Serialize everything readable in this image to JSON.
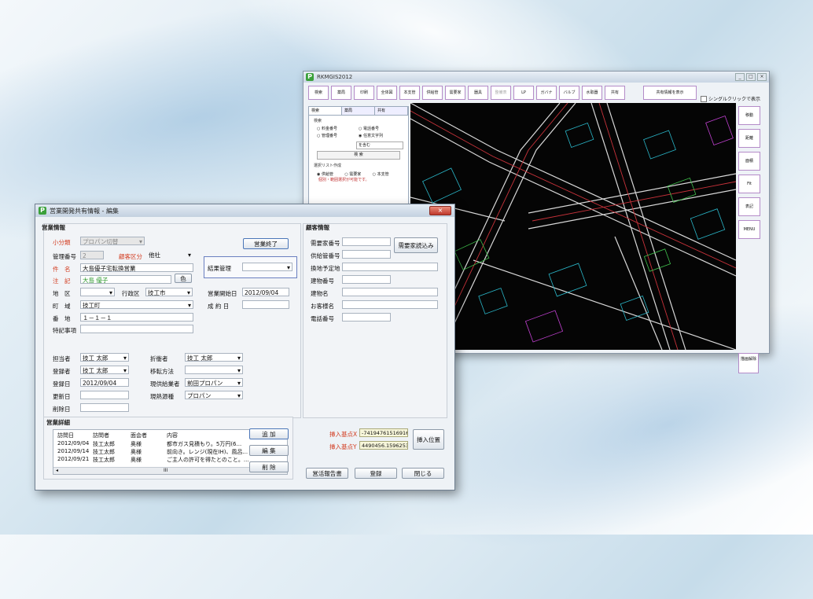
{
  "back_window": {
    "title": "RKMGIS2012",
    "toolbar": [
      "検索",
      "薬局",
      "印刷",
      "全体図",
      "本支管",
      "供給管",
      "需要家",
      "器具",
      "整備表",
      "LP",
      "ガバナ",
      "バルブ",
      "水取器",
      "共有"
    ],
    "toolbar_disabled_index": 8,
    "show_all_label": "共有情報を表示",
    "single_click_label": "シングルクリックで表示",
    "side_buttons": [
      "移動",
      "距離",
      "面積",
      "Fit",
      "表記",
      "MENU",
      "描画解除"
    ],
    "left_panel": {
      "tabs": [
        "検索",
        "薬局",
        "共有"
      ],
      "section_title": "検索",
      "radios": [
        {
          "label": "料金番号",
          "on": false
        },
        {
          "label": "電話番号",
          "on": false
        },
        {
          "label": "管理番号",
          "on": false
        },
        {
          "label": "任意文字列",
          "on": true
        }
      ],
      "select_value": "を含む",
      "search_button": "検 索",
      "list_title": "選択リスト作成",
      "list_radios": [
        "供給管",
        "需要家",
        "本支管"
      ],
      "list_note": "個別・範囲選択が可能です。"
    },
    "map_colors": {
      "line": "#d8d8d8",
      "red": "#c8323a",
      "cyan": "#2ab6c8",
      "green": "#3fbf4c",
      "magenta": "#c040d0"
    }
  },
  "front_window": {
    "title": "営業開発共有情報 - 編集",
    "close_label": "×",
    "sales_info": {
      "section_title": "営業情報",
      "small_category_label": "小分類",
      "small_category_value": "プロパン切替",
      "end_sales_button": "営業終了",
      "mgmt_no_label": "管理番号",
      "mgmt_no_value": "2",
      "customer_type_label": "顧客区分",
      "customer_type_value": "他社",
      "subject_label": "件　名",
      "subject_value": "大島優子宅転換営業",
      "note_label": "注　記",
      "note_value": "大島 優子",
      "color_button": "色",
      "result_label": "結果管理",
      "area_label": "地　区",
      "ward_label": "行政区",
      "ward_value": "技工市",
      "sales_start_label": "営業開始日",
      "sales_start_value": "2012/09/04",
      "town_label": "町　域",
      "town_value": "技工町",
      "contract_date_label": "成 約 日",
      "address_label": "番　地",
      "address_value": "１－１－１",
      "remarks_label": "特記事項"
    },
    "people": {
      "person_label": "担当者",
      "person_value": "技工 太郎",
      "negotiator_label": "折衝者",
      "negotiator_value": "技工 太郎",
      "registrant_label": "登録者",
      "registrant_value": "技工 太郎",
      "move_method_label": "移転方法",
      "reg_date_label": "登録日",
      "reg_date_value": "2012/09/04",
      "current_supplier_label": "現供給業者",
      "current_supplier_value": "前田プロパン",
      "update_date_label": "更新日",
      "current_heat_label": "現熱源種",
      "current_heat_value": "プロパン",
      "delete_date_label": "削除日"
    },
    "customer_info": {
      "section_title": "顧客情報",
      "fields": [
        "需要家番号",
        "供給管番号",
        "換地予定地",
        "建物番号",
        "建物名",
        "お客様名",
        "電話番号"
      ],
      "load_button": "需要家読込み"
    },
    "details": {
      "section_title": "営業詳細",
      "columns": [
        "訪問日",
        "訪問者",
        "面会者",
        "内容"
      ],
      "rows": [
        [
          "2012/09/04",
          "技工太郎",
          "奥様",
          "都市ガス見積もり。5万円(6..."
        ],
        [
          "2012/09/14",
          "技工太郎",
          "奥様",
          "前向き。レンジ(現在IH)、風呂..."
        ],
        [
          "2012/09/21",
          "技工太郎",
          "奥様",
          "ご主人の許可を得たとのこと。..."
        ]
      ],
      "add_button": "追 加",
      "edit_button": "編 集",
      "delete_button": "削 除",
      "scroll_mark": "III"
    },
    "insert_point": {
      "x_label": "挿入基点X",
      "x_value": "-741947615169163",
      "y_label": "挿入基点Y",
      "y_value": "4490456.15962537",
      "button": "挿入位置"
    },
    "footer": {
      "report_button": "営活報告書",
      "register_button": "登録",
      "close_button": "閉じる"
    }
  }
}
